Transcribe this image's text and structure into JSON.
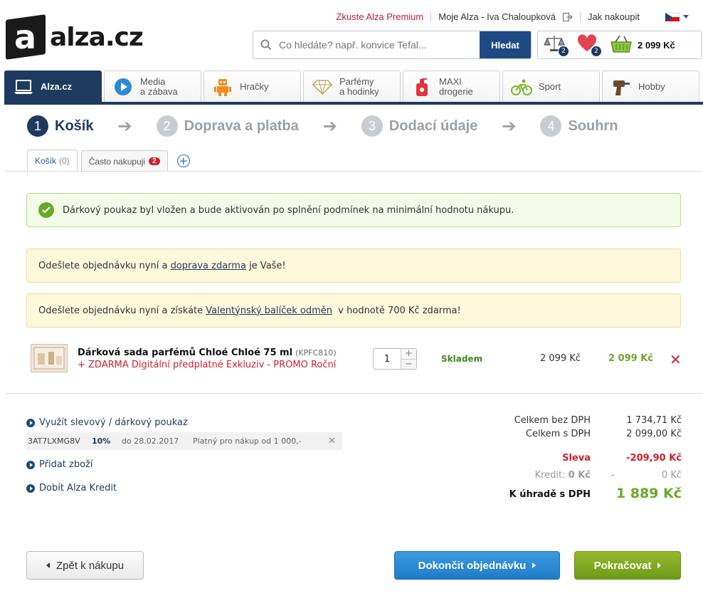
{
  "brand": {
    "logo_letter": "a",
    "logo_text": "alza.cz"
  },
  "toplinks": {
    "premium": "Zkuste Alza Premium",
    "account": "Moje Alza - Iva Chaloupková",
    "howto": "Jak nakoupit"
  },
  "search": {
    "placeholder": "Co hledáte? např. konvice Tefal...",
    "button": "Hledat"
  },
  "cart": {
    "compare_count": "2",
    "favorites_count": "2",
    "total": "2 099 Kč"
  },
  "categories": [
    {
      "label1": "Alza.cz",
      "label2": "",
      "icon": "laptop-icon"
    },
    {
      "label1": "Media",
      "label2": "a zábava",
      "icon": "play-icon"
    },
    {
      "label1": "Hračky",
      "label2": "",
      "icon": "robot-icon"
    },
    {
      "label1": "Parfémy",
      "label2": "a hodinky",
      "icon": "diamond-icon"
    },
    {
      "label1": "MAXI",
      "label2": "drogerie",
      "icon": "soap-bottle-icon"
    },
    {
      "label1": "Sport",
      "label2": "",
      "icon": "cyclist-icon"
    },
    {
      "label1": "Hobby",
      "label2": "",
      "icon": "drill-icon"
    }
  ],
  "steps": [
    {
      "num": "1",
      "label": "Košík"
    },
    {
      "num": "2",
      "label": "Doprava a platba"
    },
    {
      "num": "3",
      "label": "Dodací údaje"
    },
    {
      "num": "4",
      "label": "Souhrn"
    }
  ],
  "tabs": {
    "cart_label": "Košík",
    "cart_count": "(0)",
    "frequent_label": "Často nakupuji",
    "frequent_count": "2"
  },
  "alerts": {
    "voucher": "Dárkový poukaz byl vložen a bude aktivován po splnění podmínek na minimální hodnotu nákupu.",
    "shipping_pre": "Odešlete objednávku nyní a ",
    "shipping_link": "doprava zdarma",
    "shipping_post": " je Vaše!",
    "gift_pre": "Odešlete objednávku nyní a získáte ",
    "gift_link": "Valentýnský balíček odměn",
    "gift_post": "  v hodnotě 700 Kč zdarma!"
  },
  "product": {
    "name": "Dárková sada parfémů Chloé Chloé 75 ml",
    "code": "(KPFC810)",
    "gift": "+ ZDARMA Digitální předplatné Exkluziv - PROMO Roční",
    "quantity": "1",
    "stock": "Skladem",
    "unit_price": "2 099 Kč",
    "total_price": "2 099 Kč"
  },
  "links": {
    "voucher": "Využít slevový / dárkový poukaz",
    "add": "Přidat zboží",
    "credit": "Dobít Alza Kredit"
  },
  "voucher_row": {
    "code": "3AT7LXMG8V",
    "discount": "10%",
    "valid_to": "do 28.02.2017",
    "condition": "Platný pro nákup od 1 000,-"
  },
  "summary": {
    "without_vat_label": "Celkem bez DPH",
    "without_vat": "1 734,71 Kč",
    "with_vat_label": "Celkem s DPH",
    "with_vat": "2 099,00 Kč",
    "discount_label": "Sleva",
    "discount": "-209,90 Kč",
    "credit_label": "Kredit:",
    "credit_value": "0 Kč",
    "credit_dash": "-",
    "credit_amount": "0 Kč",
    "to_pay_label": "K úhradě s DPH",
    "to_pay": "1 889 Kč"
  },
  "buttons": {
    "back": "Zpět k nákupu",
    "finish": "Dokončit objednávku",
    "continue": "Pokračovat"
  },
  "colors": {
    "brand_navy": "#1e3a5f",
    "green": "#6aa82a",
    "red": "#d1202a",
    "blue_btn": "#1f7bc6"
  }
}
